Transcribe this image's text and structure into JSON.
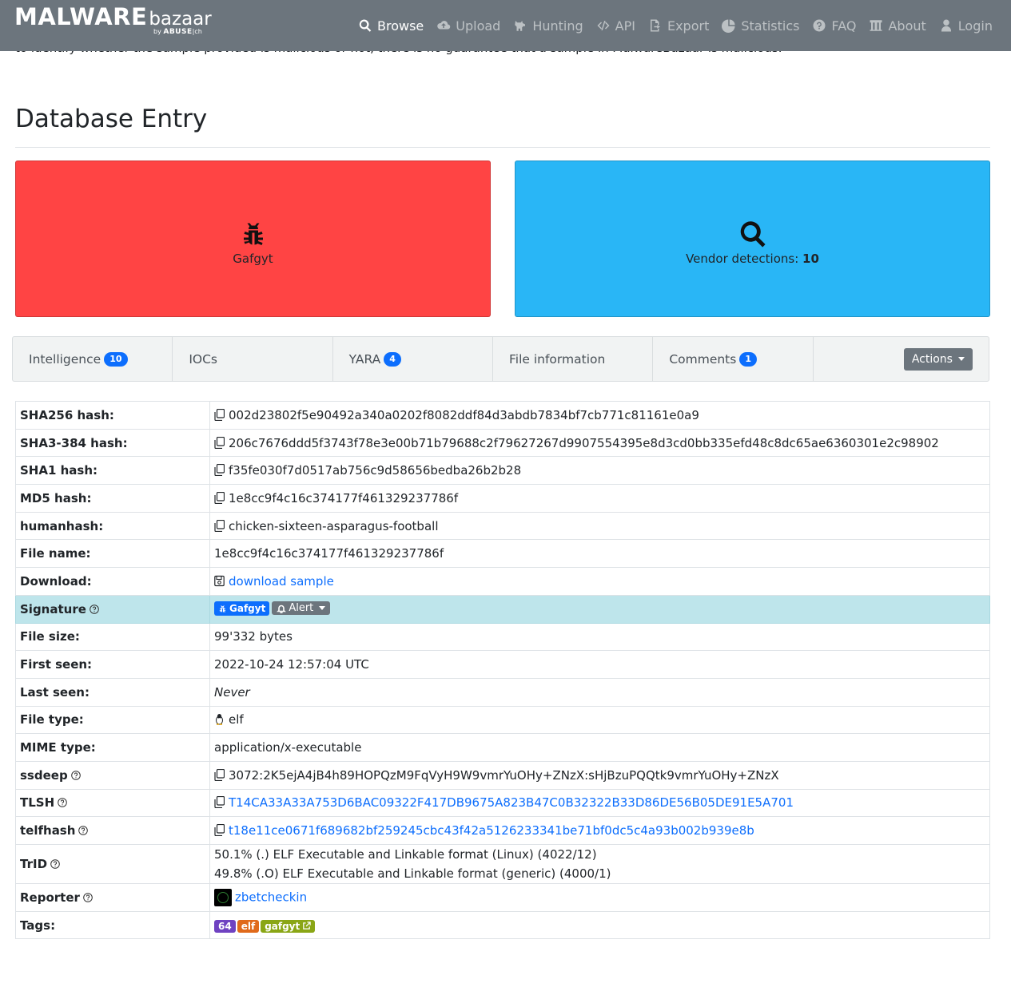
{
  "brand": {
    "name": "MALWARE",
    "sub": "bazaar",
    "by": "by",
    "org": "ABUSE",
    "org_suffix": "|ch"
  },
  "nav": [
    {
      "label": "Browse",
      "icon": "search-icon",
      "active": true
    },
    {
      "label": "Upload",
      "icon": "cloud-upload-icon",
      "active": false
    },
    {
      "label": "Hunting",
      "icon": "dog-icon",
      "active": false
    },
    {
      "label": "API",
      "icon": "code-icon",
      "active": false
    },
    {
      "label": "Export",
      "icon": "export-icon",
      "active": false
    },
    {
      "label": "Statistics",
      "icon": "pie-chart-icon",
      "active": false
    },
    {
      "label": "FAQ",
      "icon": "question-circle-icon",
      "active": false
    },
    {
      "label": "About",
      "icon": "building-icon",
      "active": false
    },
    {
      "label": "Login",
      "icon": "user-icon",
      "active": false
    }
  ],
  "cut_text": "to identify whether the sample provided is malicious or not, there is no guarantee that a sample in MalwareBazaar is malicious.",
  "page_title": "Database Entry",
  "cards": {
    "signature": {
      "label": "Gafgyt",
      "icon": "bug-icon",
      "color": "#ff4444"
    },
    "vendor": {
      "label": "Vendor detections:",
      "count": "10",
      "icon": "search-icon",
      "color": "#29b6f6"
    }
  },
  "tabs": [
    {
      "label": "Intelligence",
      "badge": "10"
    },
    {
      "label": "IOCs",
      "badge": null
    },
    {
      "label": "YARA",
      "badge": "4"
    },
    {
      "label": "File information",
      "badge": null
    },
    {
      "label": "Comments",
      "badge": "1"
    }
  ],
  "actions_label": "Actions",
  "rows": {
    "sha256": {
      "key": "SHA256 hash:",
      "value": "002d23802f5e90492a340a0202f8082ddf84d3abdb7834bf7cb771c81161e0a9"
    },
    "sha3": {
      "key": "SHA3-384 hash:",
      "value": "206c7676ddd5f3743f78e3e00b71b79688c2f79627267d9907554395e8d3cd0bb335efd48c8dc65ae6360301e2c98902"
    },
    "sha1": {
      "key": "SHA1 hash:",
      "value": "f35fe030f7d0517ab756c9d58656bedba26b2b28"
    },
    "md5": {
      "key": "MD5 hash:",
      "value": "1e8cc9f4c16c374177f461329237786f"
    },
    "humanhash": {
      "key": "humanhash:",
      "value": "chicken-sixteen-asparagus-football"
    },
    "filename": {
      "key": "File name:",
      "value": "1e8cc9f4c16c374177f461329237786f"
    },
    "download": {
      "key": "Download:",
      "value": "download sample"
    },
    "signature": {
      "key": "Signature",
      "badge": "Gafgyt",
      "alert": "Alert"
    },
    "filesize": {
      "key": "File size:",
      "value": "99'332 bytes"
    },
    "firstseen": {
      "key": "First seen:",
      "value": "2022-10-24 12:57:04 UTC"
    },
    "lastseen": {
      "key": "Last seen:",
      "value": "Never"
    },
    "filetype": {
      "key": "File type:",
      "value": "elf"
    },
    "mime": {
      "key": "MIME type:",
      "value": "application/x-executable"
    },
    "ssdeep": {
      "key": "ssdeep",
      "value": "3072:2K5ejA4jB4h89HOPQzM9FqVyH9W9vmrYuOHy+ZNzX:sHjBzuPQQtk9vmrYuOHy+ZNzX"
    },
    "tlsh": {
      "key": "TLSH",
      "value": "T14CA33A33A753D6BAC09322F417DB9675A823B47C0B32322B33D86DE56B05DE91E5A701"
    },
    "telfhash": {
      "key": "telfhash",
      "value": "t18e11ce0671f689682bf259245cbc43f42a5126233341be71bf0dc5c4a93b002b939e8b"
    },
    "trid": {
      "key": "TrID",
      "lines": [
        "50.1% (.) ELF Executable and Linkable format (Linux) (4022/12)",
        "49.8% (.O) ELF Executable and Linkable format (generic) (4000/1)"
      ]
    },
    "reporter": {
      "key": "Reporter",
      "value": "zbetcheckin"
    },
    "tags": {
      "key": "Tags:",
      "items": [
        {
          "label": "64",
          "color": "#6f42c1"
        },
        {
          "label": "elf",
          "color": "#e06a1b"
        },
        {
          "label": "gafgyt",
          "color": "#8aa616"
        }
      ]
    }
  }
}
